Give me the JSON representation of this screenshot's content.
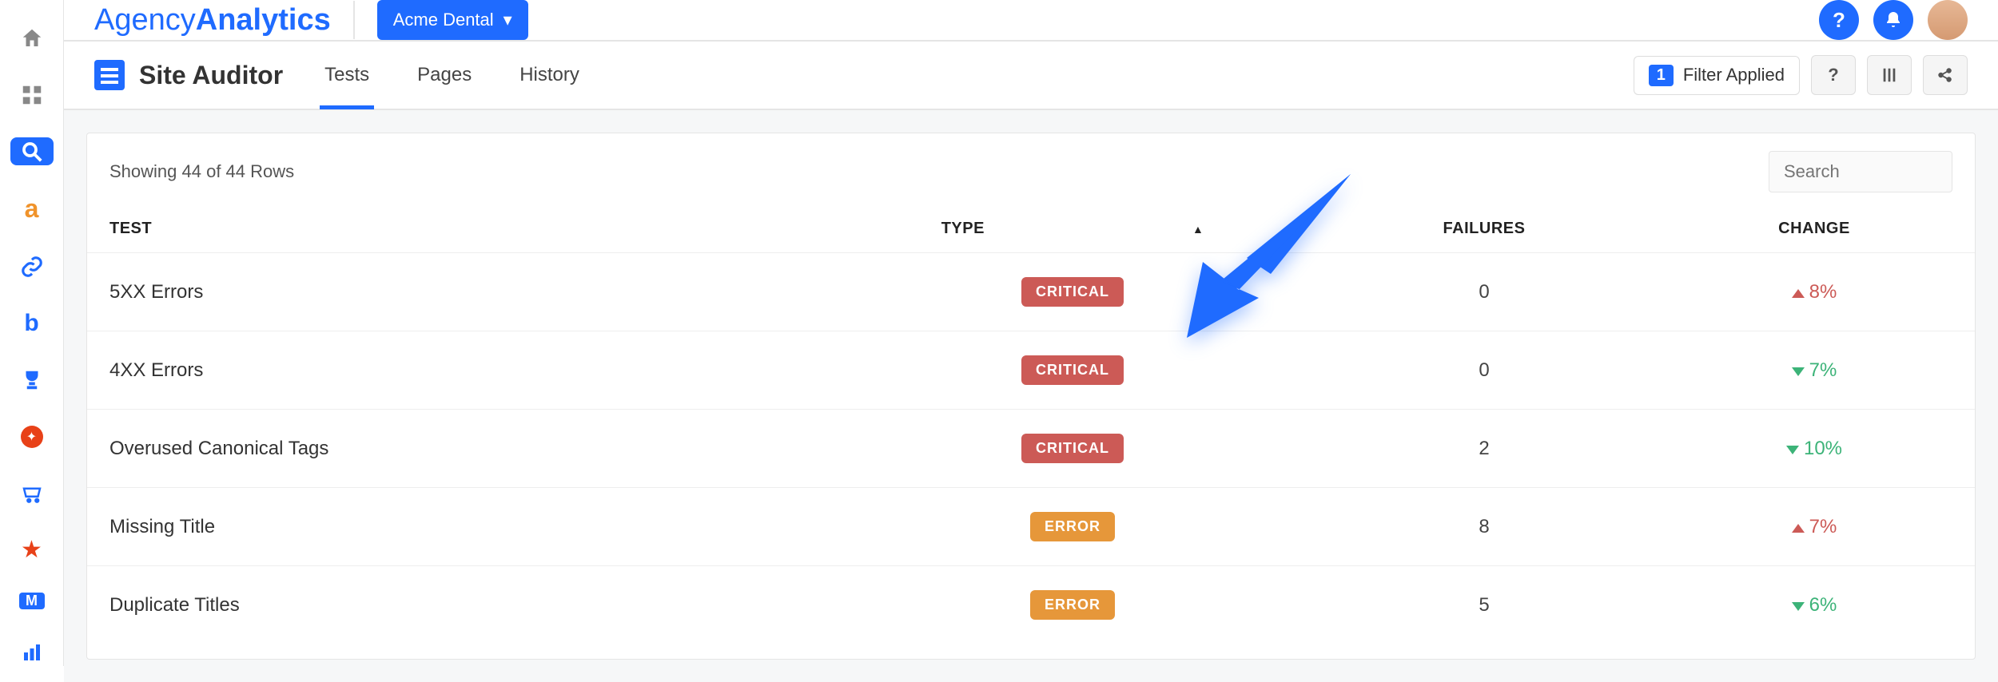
{
  "brand": {
    "part1": "Agency",
    "part2": "Analytics"
  },
  "client_picker": {
    "label": "Acme Dental"
  },
  "page": {
    "title": "Site Auditor"
  },
  "tabs": [
    {
      "label": "Tests",
      "active": true
    },
    {
      "label": "Pages",
      "active": false
    },
    {
      "label": "History",
      "active": false
    }
  ],
  "filter": {
    "count": "1",
    "label": "Filter Applied"
  },
  "search": {
    "placeholder": "Search"
  },
  "rows_label": "Showing 44 of 44 Rows",
  "headers": {
    "test": "TEST",
    "type": "TYPE",
    "failures": "FAILURES",
    "change": "CHANGE"
  },
  "rows": [
    {
      "test": "5XX Errors",
      "type": "CRITICAL",
      "failures": "0",
      "change_dir": "up",
      "change": "8%"
    },
    {
      "test": "4XX Errors",
      "type": "CRITICAL",
      "failures": "0",
      "change_dir": "down",
      "change": "7%"
    },
    {
      "test": "Overused Canonical Tags",
      "type": "CRITICAL",
      "failures": "2",
      "change_dir": "down",
      "change": "10%"
    },
    {
      "test": "Missing Title",
      "type": "ERROR",
      "failures": "8",
      "change_dir": "up",
      "change": "7%"
    },
    {
      "test": "Duplicate Titles",
      "type": "ERROR",
      "failures": "5",
      "change_dir": "down",
      "change": "6%"
    }
  ],
  "rail": [
    {
      "name": "home",
      "color": "#888"
    },
    {
      "name": "grid",
      "color": "#888"
    },
    {
      "name": "search",
      "color": "#fff",
      "active": true
    },
    {
      "name": "a",
      "color": "#f0932b"
    },
    {
      "name": "link",
      "color": "#1f6bff"
    },
    {
      "name": "bing",
      "color": "#1f6bff"
    },
    {
      "name": "trophy",
      "color": "#1f6bff"
    },
    {
      "name": "semrush",
      "color": "#e84118"
    },
    {
      "name": "cart",
      "color": "#1f6bff"
    },
    {
      "name": "star",
      "color": "#e84118"
    },
    {
      "name": "moz",
      "color": "#1f6bff"
    },
    {
      "name": "bars",
      "color": "#1f6bff"
    }
  ]
}
